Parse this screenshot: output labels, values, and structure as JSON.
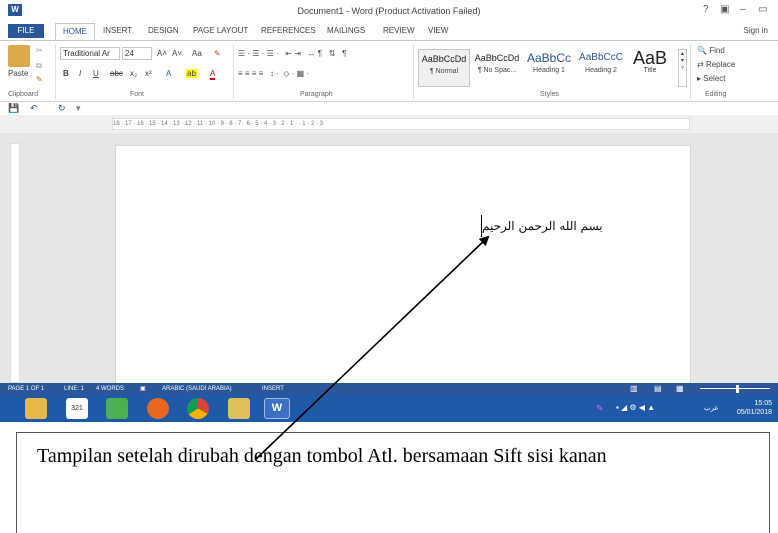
{
  "window": {
    "app_icon": "W",
    "title": "Document1 - Word (Product Activation Failed)",
    "help": "?",
    "ribbon_display": "▣",
    "minimize": "–",
    "restore": "▭",
    "close": "✕"
  },
  "tabs": [
    "FILE",
    "HOME",
    "INSERT",
    "DESIGN",
    "PAGE LAYOUT",
    "REFERENCES",
    "MAILINGS",
    "REVIEW",
    "VIEW"
  ],
  "signin": "Sign in",
  "clipboard": {
    "paste": "Paste",
    "label": "Clipboard"
  },
  "font": {
    "name": "Traditional Ar",
    "size": "24",
    "grow": "A˄",
    "shrink": "A˅",
    "case": "Aa",
    "clear": "✎",
    "bold": "B",
    "italic": "I",
    "underline": "U",
    "strike": "abc",
    "sub": "x₂",
    "sup": "x²",
    "effects": "A",
    "highlight": "ab",
    "color": "A",
    "label": "Font"
  },
  "paragraph": {
    "label": "Paragraph",
    "row1": "☰ · ☰ · ☰ ·   ⇤ ⇥   ↔ ¶   ⇅   ¶",
    "row2": "≡ ≡ ≡ ≡   ↕ ·  ◇ · ▦ ·"
  },
  "styles": {
    "label": "Styles",
    "items": [
      {
        "preview": "AaBbCcDd",
        "name": "¶ Normal"
      },
      {
        "preview": "AaBbCcDd",
        "name": "¶ No Spac..."
      },
      {
        "preview": "AaBbCc",
        "name": "Heading 1"
      },
      {
        "preview": "AaBbCcC",
        "name": "Heading 2"
      },
      {
        "preview": "AaB",
        "name": "Title"
      }
    ]
  },
  "editing": {
    "find": "Find",
    "replace": "Replace",
    "select": "Select",
    "label": "Editing"
  },
  "qat": {
    "save": "💾",
    "undo": "↶",
    "redo": "↻",
    "more": "▾"
  },
  "ruler": "18 · 17 · 16 · 15 · 14 · 13 · 12 · 11 · 10 · 9 · 8 · 7 · 6 · 5 · 4 · 3 · 2 · 1 ·   · 1 · 2 · 3",
  "document": {
    "text": "بسم الله الرحمن الرحيم"
  },
  "status": {
    "page": "PAGE 1 OF 1",
    "line": "LINE: 1",
    "words": "4 WORDS",
    "language": "ARABIC (SAUDI ARABIA)",
    "mode": "INSERT"
  },
  "taskbar": {
    "apps": [
      "file-explorer",
      "calendar",
      "store",
      "firefox",
      "chrome",
      "tool",
      "word"
    ],
    "calendar_number": "321",
    "word_label": "W",
    "lang": "عرب",
    "time": "15:05",
    "date": "05/01/2018"
  },
  "caption": "Tampilan setelah dirubah dengan tombol Atl. bersamaan Sift sisi kanan",
  "colors": {
    "accent": "#2b579a",
    "taskbar": "#1e5aa8",
    "canvas": "#e6e6e6"
  }
}
